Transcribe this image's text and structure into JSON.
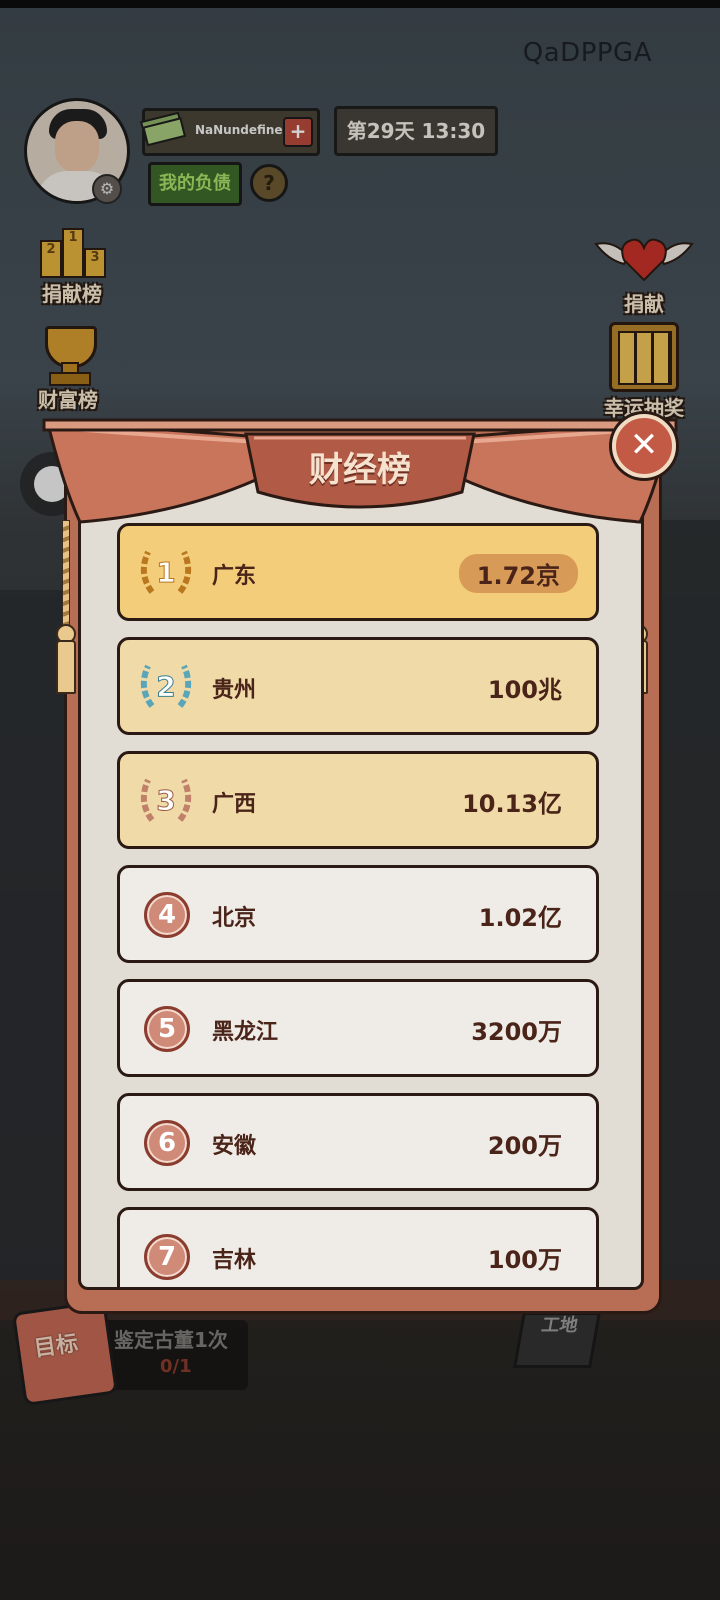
{
  "header": {
    "user_id": "QaDPPGA",
    "money": "NaNundefined",
    "money_plus": "+",
    "day_time": "第29天 13:30",
    "debt_button": "我的负债",
    "help": "?"
  },
  "side": {
    "contribution_board": "捐献榜",
    "podium_numbers": [
      "2",
      "1",
      "3"
    ],
    "wealth_board": "财富榜",
    "donate": "捐献",
    "lottery": "幸运抽奖"
  },
  "panel": {
    "title": "财经榜",
    "close": "✕",
    "rows": [
      {
        "rank": "1",
        "name": "广东",
        "value": "1.72京"
      },
      {
        "rank": "2",
        "name": "贵州",
        "value": "100兆"
      },
      {
        "rank": "3",
        "name": "广西",
        "value": "10.13亿"
      },
      {
        "rank": "4",
        "name": "北京",
        "value": "1.02亿"
      },
      {
        "rank": "5",
        "name": "黑龙江",
        "value": "3200万"
      },
      {
        "rank": "6",
        "name": "安徽",
        "value": "200万"
      },
      {
        "rank": "7",
        "name": "吉林",
        "value": "100万"
      }
    ]
  },
  "bottom": {
    "goal_label": "目标",
    "goal_task": "鉴定古董1次",
    "goal_progress": "0/1",
    "site_sign": "工地"
  },
  "colors": {
    "gold_row": "#f3cd7a",
    "top_row": "#efdaa8",
    "panel": "#b86d55",
    "rank_badge": "#d08a78"
  }
}
